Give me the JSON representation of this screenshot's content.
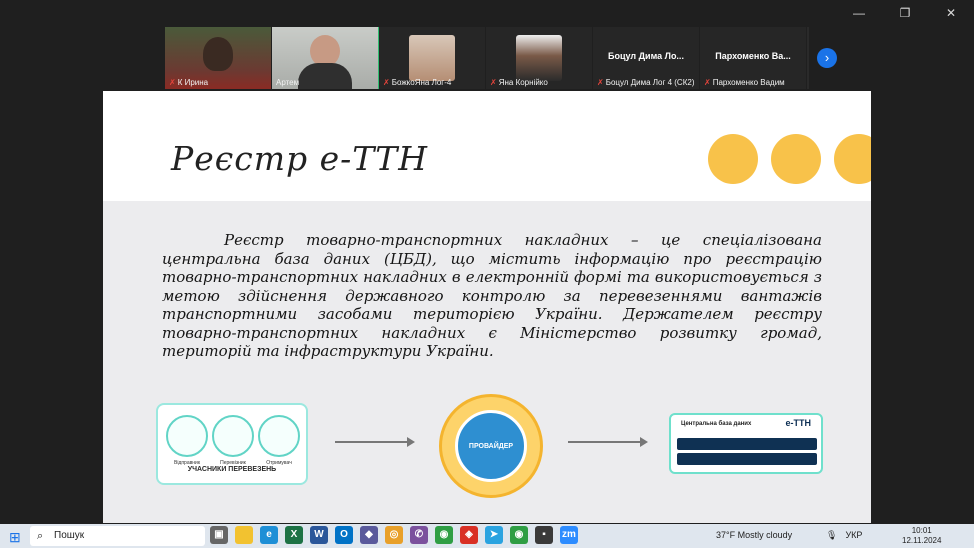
{
  "window": {
    "minimize": "—",
    "maximize": "❐",
    "close": "✕"
  },
  "participants": [
    {
      "name": "К Ирина",
      "muted": true
    },
    {
      "name": "Артем",
      "muted": false,
      "active": true
    },
    {
      "name": "БожкоЯна Лог-4",
      "muted": true
    },
    {
      "name": "Яна Корнійко",
      "muted": true
    },
    {
      "display": "Боцул Дима Ло...",
      "name": "Боцул Дима Лог 4 (СК2)",
      "muted": true
    },
    {
      "display": "Пархоменко Ва...",
      "name": "Пархоменко Вадим",
      "muted": true
    }
  ],
  "slide": {
    "title": "Реєстр е-ТТН",
    "body": "Реєстр товарно-транспортних накладних – це спеціалізована центральна база даних (ЦБД), що містить інформацію про реєстрацію товарно-транспортних накладних в електронній формі та використовується з метою здійснення державного контролю за перевезеннями вантажів транспортними засобами територією України. Держателем реєстру товарно-транспортних накладних є Міністерство розвитку громад, територій та інфраструктури України.",
    "diagram": {
      "participants": [
        "Відправник",
        "Перевізник",
        "Отримувач"
      ],
      "participants_label": "УЧАСНИКИ ПЕРЕВЕЗЕНЬ",
      "provider": "ПРОВАЙДЕР",
      "db_title": "Центральна база даних",
      "db_logo": "е-TTH"
    },
    "accent_color": "#f8c24a"
  },
  "taskbar": {
    "search_placeholder": "Пошук",
    "weather": "37°F  Mostly cloudy",
    "lang": "УКР",
    "time": "10:01",
    "date": "12.11.2024"
  }
}
